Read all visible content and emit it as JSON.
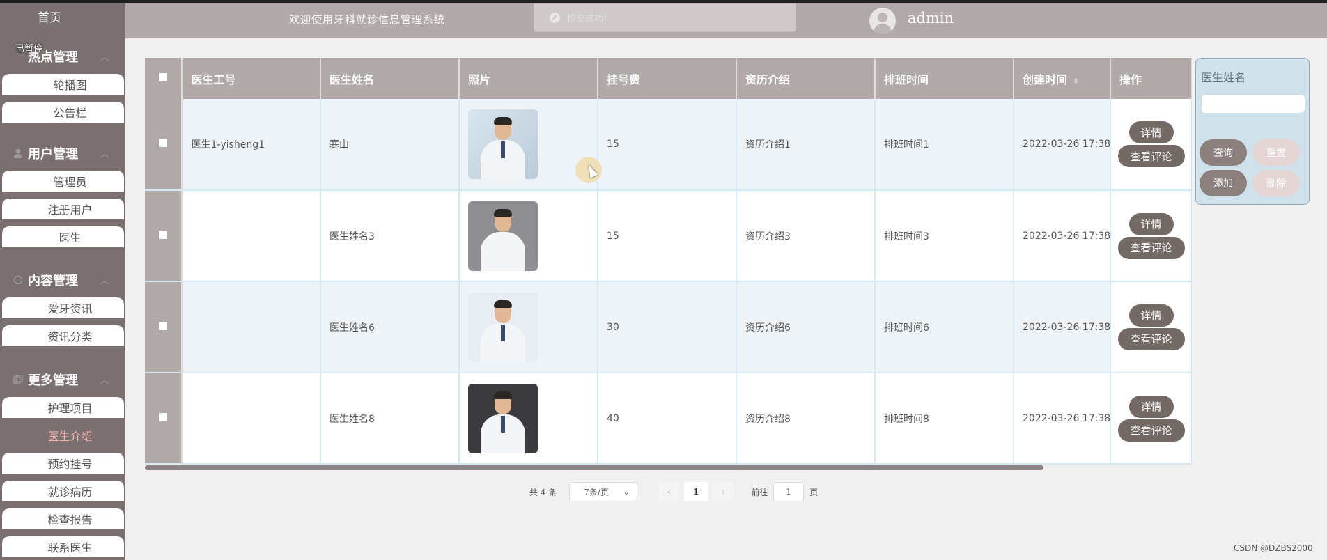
{
  "header": {
    "welcome": "欢迎使用牙科就诊信息管理系统",
    "toast": "提交成功!",
    "username": "admin"
  },
  "sidebar": {
    "home": "首页",
    "paused_tag": "已暂停",
    "groups": [
      {
        "label": "热点管理",
        "icon": "hot-icon"
      },
      {
        "label": "用户管理",
        "icon": "user-icon"
      },
      {
        "label": "内容管理",
        "icon": "chat-icon"
      },
      {
        "label": "更多管理",
        "icon": "more-icon"
      }
    ],
    "items": {
      "carousel": "轮播图",
      "notice": "公告栏",
      "admin": "管理员",
      "registered": "注册用户",
      "doctor": "医生",
      "news": "爱牙资讯",
      "news_category": "资讯分类",
      "care": "护理项目",
      "doctor_intro": "医生介绍",
      "appointment": "预约挂号",
      "records": "就诊病历",
      "reports": "检查报告",
      "contact": "联系医生"
    }
  },
  "table": {
    "columns": [
      "医生工号",
      "医生姓名",
      "照片",
      "挂号费",
      "资历介绍",
      "排班时间",
      "创建时间",
      "操作"
    ],
    "rows": [
      {
        "id": "医生1-yisheng1",
        "name": "寒山",
        "fee": "15",
        "intro": "资历介绍1",
        "schedule": "排班时间1",
        "created": "2022-03-26 17:38"
      },
      {
        "id": "",
        "name": "医生姓名3",
        "fee": "15",
        "intro": "资历介绍3",
        "schedule": "排班时间3",
        "created": "2022-03-26 17:38"
      },
      {
        "id": "",
        "name": "医生姓名6",
        "fee": "30",
        "intro": "资历介绍6",
        "schedule": "排班时间6",
        "created": "2022-03-26 17:38"
      },
      {
        "id": "",
        "name": "医生姓名8",
        "fee": "40",
        "intro": "资历介绍8",
        "schedule": "排班时间8",
        "created": "2022-03-26 17:38"
      }
    ],
    "actions": {
      "detail": "详情",
      "comments": "查看评论"
    }
  },
  "search": {
    "label": "医生姓名",
    "value": "",
    "query": "查询",
    "reset": "重置",
    "add": "添加",
    "delete": "删除"
  },
  "pager": {
    "total": "共 4 条",
    "page_size": "7条/页",
    "current": "1",
    "goto_prefix": "前往",
    "goto_value": "1",
    "goto_suffix": "页"
  },
  "watermark": "CSDN @DZBS2000",
  "colors": {
    "sidebar": "#7a7070",
    "header": "#b2aaa8",
    "accent_button": "#736965",
    "active_item_text": "#f2b3b3"
  }
}
